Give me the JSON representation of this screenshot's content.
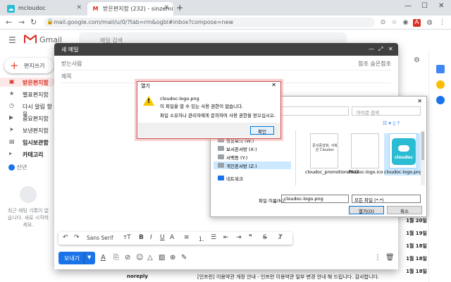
{
  "browser": {
    "tabs": [
      {
        "label": "mcloudoc",
        "active": false
      },
      {
        "label": "받은편지함 (232) - sinzemitre@",
        "active": true
      }
    ],
    "url": "mail.google.com/mail/u/0/?tab=rm&ogbl#inbox?compose=new"
  },
  "gmail": {
    "logo_text": "Gmail",
    "search_placeholder": "메일 검색",
    "compose_label": "편지쓰기",
    "sidebar": [
      {
        "label": "받은편지함",
        "icon": "inbox-icon"
      },
      {
        "label": "별표편지함",
        "icon": "star-icon"
      },
      {
        "label": "다시 알림 항목",
        "icon": "clock-icon"
      },
      {
        "label": "중요편지함",
        "icon": "important-icon"
      },
      {
        "label": "보낸편지함",
        "icon": "send-icon"
      },
      {
        "label": "임시보관함",
        "icon": "draft-icon"
      },
      {
        "label": "카테고리",
        "icon": "category-icon"
      }
    ],
    "user": "신년",
    "side_empty_text": "최근 채팅 기록이 없습니다. 새로 시작하세요.",
    "dates": [
      "1월 20일",
      "1월 19일",
      "1월 18일",
      "1월 18일",
      "1월 18일"
    ],
    "noreply": {
      "sender": "noreply",
      "text": "[인프런] 이용약관 개정 안내 - 인프런 이용약관 일부 변경 안내 해 드립니다. 감사합니다."
    }
  },
  "compose": {
    "title": "새 메일",
    "to_label": "받는사람",
    "cc_label": "참조 숨은참조",
    "subject_label": "제목",
    "font_name": "Sans Serif",
    "send_label": "보내기"
  },
  "error_dialog": {
    "title": "열기",
    "lines": [
      "cloudoc-logo.png",
      "이 파일을 열 수 있는 사용 권한이 없습니다.",
      "파일 소유자나 관리자에게 문의하여 사용 권한을 얻으십시오."
    ],
    "ok_label": "확인"
  },
  "file_dialog": {
    "path": "아이콘",
    "search_placeholder": "아이콘 검색",
    "nav": [
      {
        "label": "영웅보늬 (W:)",
        "selected": false
      },
      {
        "label": "보서폰서방 (X:)",
        "selected": false
      },
      {
        "label": "서백등 (Y:)",
        "selected": false
      },
      {
        "label": "개인폰서방 (Z:)",
        "selected": true
      },
      {
        "label": "네트워크",
        "selected": false
      }
    ],
    "files": [
      {
        "name": "cloudoc_promotion.PNG",
        "thumb_text": "문서중앙화, 서복은 Cloudoc",
        "selected": false
      },
      {
        "name": "cloudoc-logo.ico",
        "thumb_text": "",
        "selected": false
      },
      {
        "name": "cloudoc-logo.png",
        "thumb_text": "cloudoc",
        "selected": true
      }
    ],
    "filename_label": "파일 이름(N):",
    "filename_value": "cloudoc-logo.png",
    "filetype_value": "모든 파일 (*.*)",
    "open_label": "열기(O)",
    "cancel_label": "취소"
  },
  "colors": {
    "accent": "#1a73e8",
    "gmail_red": "#d93025",
    "warning": "#f6c700"
  }
}
